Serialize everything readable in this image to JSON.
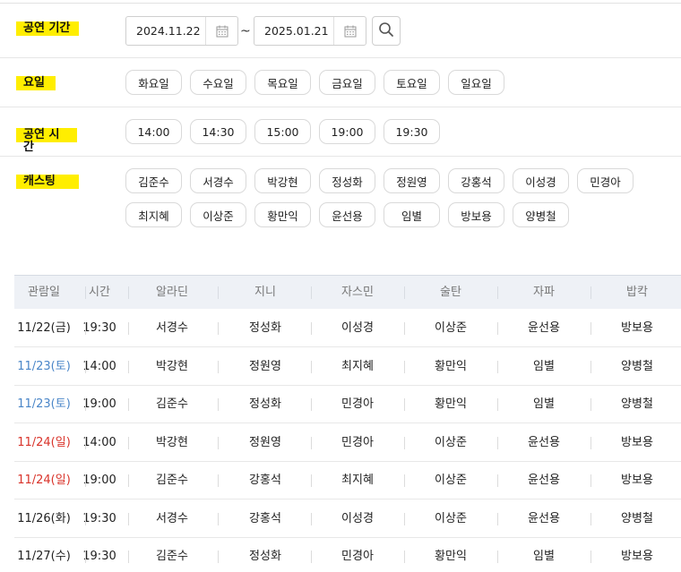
{
  "filters": {
    "period": {
      "label": "공연 기간",
      "start": "2024.11.22",
      "separator": "~",
      "end": "2025.01.21"
    },
    "day": {
      "label": "요일",
      "options": [
        "화요일",
        "수요일",
        "목요일",
        "금요일",
        "토요일",
        "일요일"
      ]
    },
    "time": {
      "label": "공연 시간",
      "options": [
        "14:00",
        "14:30",
        "15:00",
        "19:00",
        "19:30"
      ]
    },
    "cast": {
      "label": "캐스팅",
      "options": [
        "김준수",
        "서경수",
        "박강현",
        "정성화",
        "정원영",
        "강홍석",
        "이성경",
        "민경아",
        "최지혜",
        "이상준",
        "황만익",
        "윤선용",
        "임별",
        "방보용",
        "양병철"
      ]
    }
  },
  "table": {
    "columns": [
      "관람일",
      "시간",
      "알라딘",
      "지니",
      "자스민",
      "술탄",
      "자파",
      "밥칵"
    ],
    "rows": [
      {
        "date": "11/22(금)",
        "day_color": "#222222",
        "cells": [
          "19:30",
          "서경수",
          "정성화",
          "이성경",
          "이상준",
          "윤선용",
          "방보용"
        ]
      },
      {
        "date": "11/23(토)",
        "day_color": "#4a86c8",
        "cells": [
          "14:00",
          "박강현",
          "정원영",
          "최지혜",
          "황만익",
          "임별",
          "양병철"
        ]
      },
      {
        "date": "11/23(토)",
        "day_color": "#4a86c8",
        "cells": [
          "19:00",
          "김준수",
          "정성화",
          "민경아",
          "황만익",
          "임별",
          "양병철"
        ]
      },
      {
        "date": "11/24(일)",
        "day_color": "#d9342b",
        "cells": [
          "14:00",
          "박강현",
          "정원영",
          "민경아",
          "이상준",
          "윤선용",
          "방보용"
        ]
      },
      {
        "date": "11/24(일)",
        "day_color": "#d9342b",
        "cells": [
          "19:00",
          "김준수",
          "강홍석",
          "최지혜",
          "이상준",
          "윤선용",
          "방보용"
        ]
      },
      {
        "date": "11/26(화)",
        "day_color": "#222222",
        "cells": [
          "19:30",
          "서경수",
          "강홍석",
          "이성경",
          "이상준",
          "윤선용",
          "양병철"
        ]
      },
      {
        "date": "11/27(수)",
        "day_color": "#222222",
        "cells": [
          "19:30",
          "김준수",
          "정성화",
          "민경아",
          "황만익",
          "임별",
          "방보용"
        ]
      }
    ]
  },
  "icons": {
    "calendar": "calendar-icon",
    "search": "search-icon"
  }
}
